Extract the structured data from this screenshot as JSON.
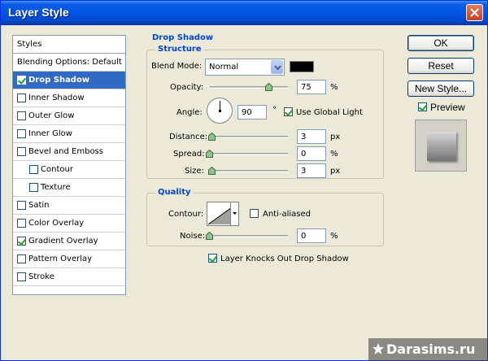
{
  "window": {
    "title": "Layer Style"
  },
  "styles_panel": {
    "header": "Styles",
    "items": [
      {
        "label": "Blending Options: Default",
        "checkbox": false,
        "checked": false,
        "indent": false,
        "selected": false
      },
      {
        "label": "Drop Shadow",
        "checkbox": true,
        "checked": true,
        "indent": false,
        "selected": true
      },
      {
        "label": "Inner Shadow",
        "checkbox": true,
        "checked": false,
        "indent": false,
        "selected": false
      },
      {
        "label": "Outer Glow",
        "checkbox": true,
        "checked": false,
        "indent": false,
        "selected": false
      },
      {
        "label": "Inner Glow",
        "checkbox": true,
        "checked": false,
        "indent": false,
        "selected": false
      },
      {
        "label": "Bevel and Emboss",
        "checkbox": true,
        "checked": false,
        "indent": false,
        "selected": false
      },
      {
        "label": "Contour",
        "checkbox": true,
        "checked": false,
        "indent": true,
        "selected": false
      },
      {
        "label": "Texture",
        "checkbox": true,
        "checked": false,
        "indent": true,
        "selected": false
      },
      {
        "label": "Satin",
        "checkbox": true,
        "checked": false,
        "indent": false,
        "selected": false
      },
      {
        "label": "Color Overlay",
        "checkbox": true,
        "checked": false,
        "indent": false,
        "selected": false
      },
      {
        "label": "Gradient Overlay",
        "checkbox": true,
        "checked": true,
        "indent": false,
        "selected": false
      },
      {
        "label": "Pattern Overlay",
        "checkbox": true,
        "checked": false,
        "indent": false,
        "selected": false
      },
      {
        "label": "Stroke",
        "checkbox": true,
        "checked": false,
        "indent": false,
        "selected": false
      }
    ]
  },
  "drop_shadow": {
    "title": "Drop Shadow",
    "structure": {
      "title": "Structure",
      "blend_mode_label": "Blend Mode:",
      "blend_mode_value": "Normal",
      "shadow_color": "#000000",
      "opacity_label": "Opacity:",
      "opacity_value": "75",
      "opacity_fraction": 0.75,
      "opacity_unit": "%",
      "angle_label": "Angle:",
      "angle_value": "90",
      "angle_unit": "°",
      "use_global_light_label": "Use Global Light",
      "use_global_light_checked": true,
      "distance_label": "Distance:",
      "distance_value": "3",
      "distance_unit": "px",
      "spread_label": "Spread:",
      "spread_value": "0",
      "spread_unit": "%",
      "size_label": "Size:",
      "size_value": "3",
      "size_unit": "px"
    },
    "quality": {
      "title": "Quality",
      "contour_label": "Contour:",
      "anti_aliased_label": "Anti-aliased",
      "anti_aliased_checked": false,
      "noise_label": "Noise:",
      "noise_value": "0",
      "noise_unit": "%"
    },
    "knockout_label": "Layer Knocks Out Drop Shadow",
    "knockout_checked": true
  },
  "buttons": {
    "ok": "OK",
    "reset": "Reset",
    "new_style": "New Style...",
    "preview_label": "Preview",
    "preview_checked": true
  },
  "watermark": {
    "text": "Darasims.ru"
  },
  "colors": {
    "title_bar": "#0055e5",
    "selection": "#316ac5",
    "group_title": "#0046d5",
    "background": "#ece9d8"
  },
  "icons": {
    "close": "close-icon",
    "dropdown": "chevron-down-icon",
    "slider_thumb": "slider-thumb-icon",
    "dial": "angle-dial-icon",
    "contour": "contour-curve-icon",
    "star": "star-icon"
  }
}
